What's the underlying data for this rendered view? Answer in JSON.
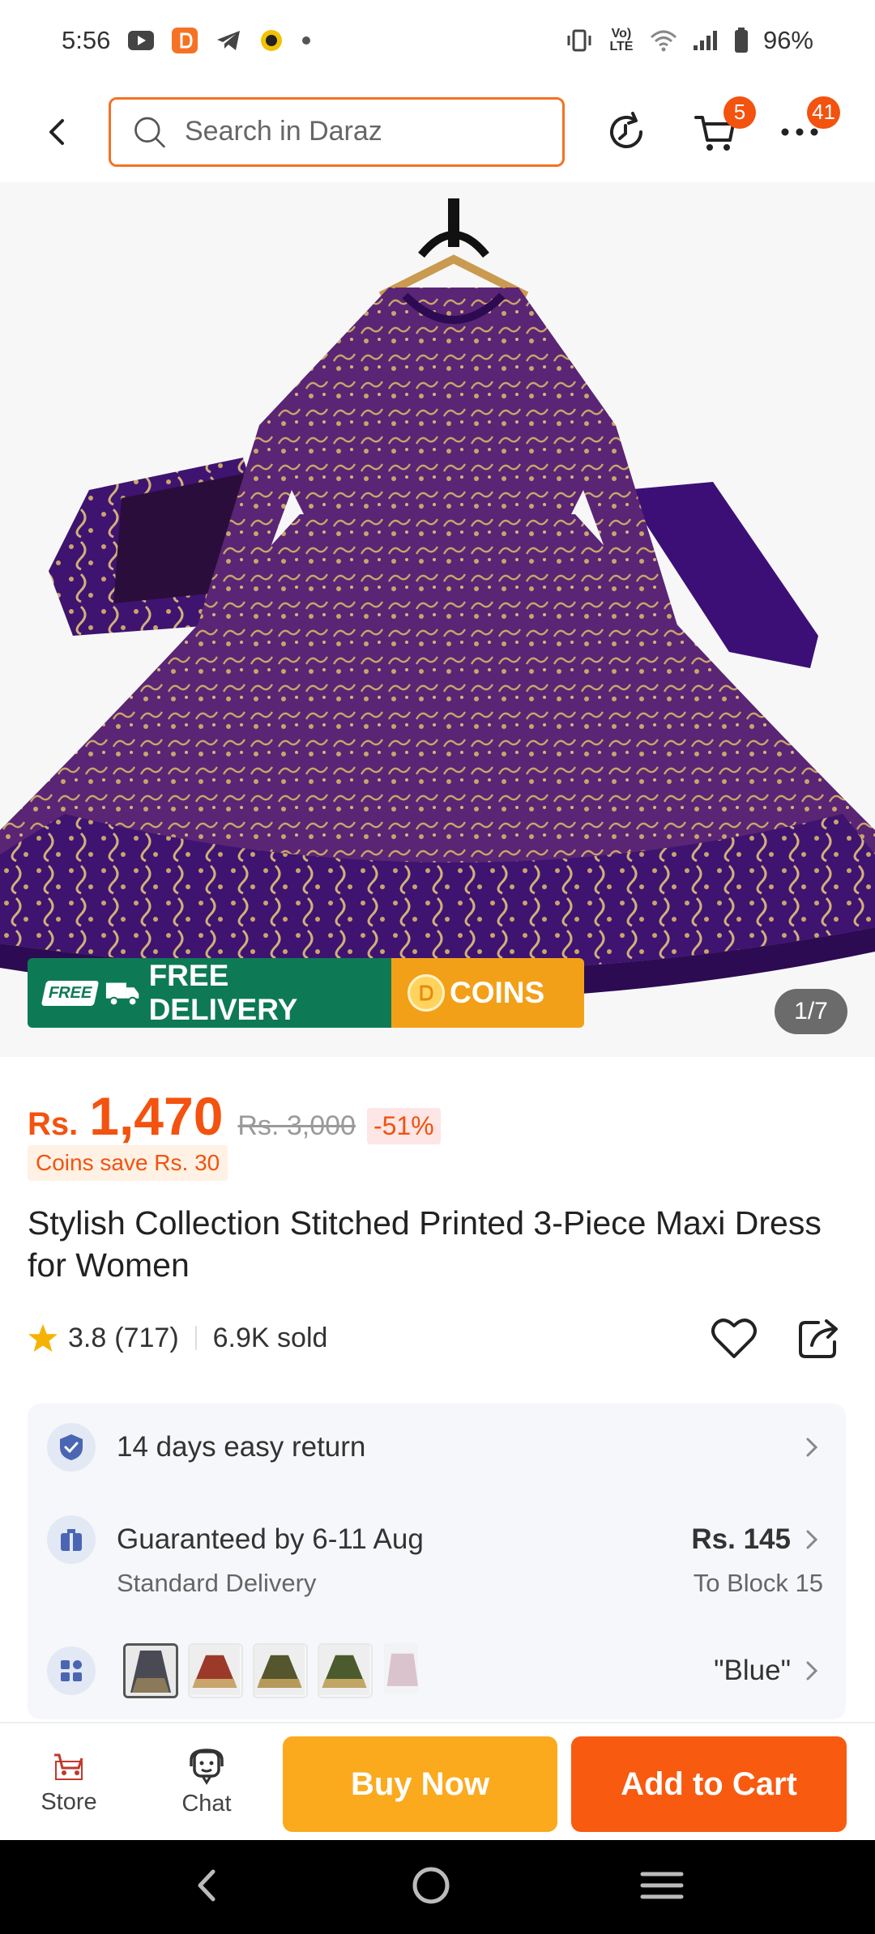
{
  "status_bar": {
    "time": "5:56",
    "battery": "96%",
    "lte_label": "Vo) LTE"
  },
  "header": {
    "search_placeholder": "Search in Daraz",
    "cart_badge": "5",
    "more_badge": "41"
  },
  "gallery": {
    "promo_free_tag": "FREE",
    "promo_free_label": "FREE DELIVERY",
    "promo_coins_label": "COINS",
    "counter": "1/7"
  },
  "price": {
    "currency": "Rs.",
    "value": "1,470",
    "original": "Rs. 3,000",
    "discount": "-51%",
    "coins_save": "Coins save Rs. 30"
  },
  "product": {
    "title": "Stylish Collection Stitched Printed 3-Piece Maxi Dress for Women",
    "rating": "3.8",
    "rating_count": "(717)",
    "sold": "6.9K sold"
  },
  "info": {
    "return_text": "14 days easy return",
    "delivery_text": "Guaranteed by 6-11 Aug",
    "delivery_sub": "Standard Delivery",
    "delivery_price": "Rs. 145",
    "delivery_dest": "To Block 15",
    "variant_value": "\"Blue\""
  },
  "actions": {
    "store_label": "Store",
    "chat_label": "Chat",
    "buy_now": "Buy Now",
    "add_to_cart": "Add to Cart"
  },
  "colors": {
    "brand_orange": "#f57224",
    "price_red": "#f3520f",
    "buy_now": "#fbaa1e",
    "add_to_cart": "#f85a10",
    "free_delivery_green": "#0e7a55",
    "dress_purple": "#4a1a72"
  }
}
